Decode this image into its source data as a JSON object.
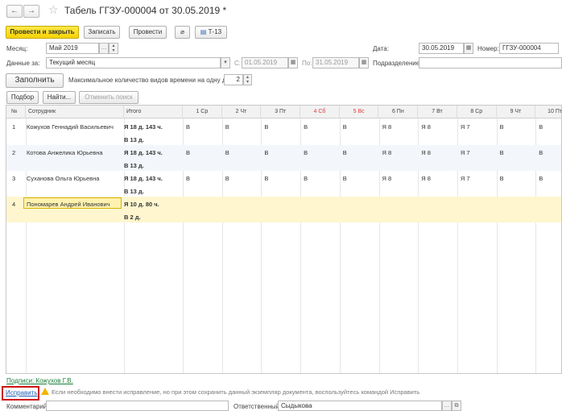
{
  "window": {
    "title": "Табель ГГЗУ-000004 от 30.05.2019 *",
    "back": "←",
    "forward": "→"
  },
  "toolbar": {
    "post_close": "Провести и закрыть",
    "save": "Записать",
    "post": "Провести",
    "print": "Т-13"
  },
  "form": {
    "month_label": "Месяц:",
    "month_value": "Май 2019",
    "date_label": "Дата:",
    "date_value": "30.05.2019",
    "number_label": "Номер:",
    "number_value": "ГГЗУ-000004",
    "data_for_label": "Данные за:",
    "data_for_value": "Текущий месяц",
    "from_label": "С:",
    "from_value": "01.05.2019",
    "to_label": "По:",
    "to_value": "31.05.2019",
    "dept_label": "Подразделение:",
    "dept_value": "",
    "fill_button": "Заполнить",
    "max_types_label": "Максимальное количество видов времени на одну дату:",
    "max_types_value": "2"
  },
  "grid_toolbar": {
    "pick": "Подбор",
    "find": "Найти...",
    "cancel_search": "Отменить поиск"
  },
  "grid": {
    "headers": {
      "num": "№",
      "employee": "Сотрудник",
      "total": "Итого",
      "days": [
        "1 Ср",
        "2 Чт",
        "3 Пт",
        "4 Сб",
        "5 Вс",
        "6 Пн",
        "7 Вт",
        "8 Ср",
        "9 Чт",
        "10 Пт"
      ],
      "weekend_days": [
        3,
        4
      ]
    },
    "rows": [
      {
        "num": "1",
        "name": "Кожухов Геннадий Васильевич",
        "total1": "Я 18 д. 143 ч.",
        "total2": "В 13 д.",
        "days": [
          "В",
          "В",
          "В",
          "В",
          "В",
          "Я 8",
          "Я 8",
          "Я 7",
          "В",
          "В"
        ]
      },
      {
        "num": "2",
        "name": "Котова Анжелика Юрьевна",
        "total1": "Я 18 д. 143 ч.",
        "total2": "В 13 д.",
        "days": [
          "В",
          "В",
          "В",
          "В",
          "В",
          "Я 8",
          "Я 8",
          "Я 7",
          "В",
          "В"
        ]
      },
      {
        "num": "3",
        "name": "Суханова Ольга Юрьевна",
        "total1": "Я 18 д. 143 ч.",
        "total2": "В 13 д.",
        "days": [
          "В",
          "В",
          "В",
          "В",
          "В",
          "Я 8",
          "Я 8",
          "Я 7",
          "В",
          "В"
        ]
      },
      {
        "num": "4",
        "name": "Пономарев Андрей Иванович",
        "total1": "Я 10 д. 80 ч.",
        "total2": "В 2 д.",
        "days": [
          "",
          "",
          "",
          "",
          "",
          "",
          "",
          "",
          "",
          ""
        ]
      }
    ]
  },
  "footer": {
    "signatures": "Подписи: Кожухов Г.В.",
    "fix_link": "Исправить",
    "warning": "Если необходимо внести исправление, но при этом сохранить данный экземпляр документа, воспользуйтесь командой Исправить",
    "comment_label": "Комментарий:",
    "comment_value": "",
    "responsible_label": "Ответственный:",
    "responsible_value": "Сыдыкова"
  }
}
